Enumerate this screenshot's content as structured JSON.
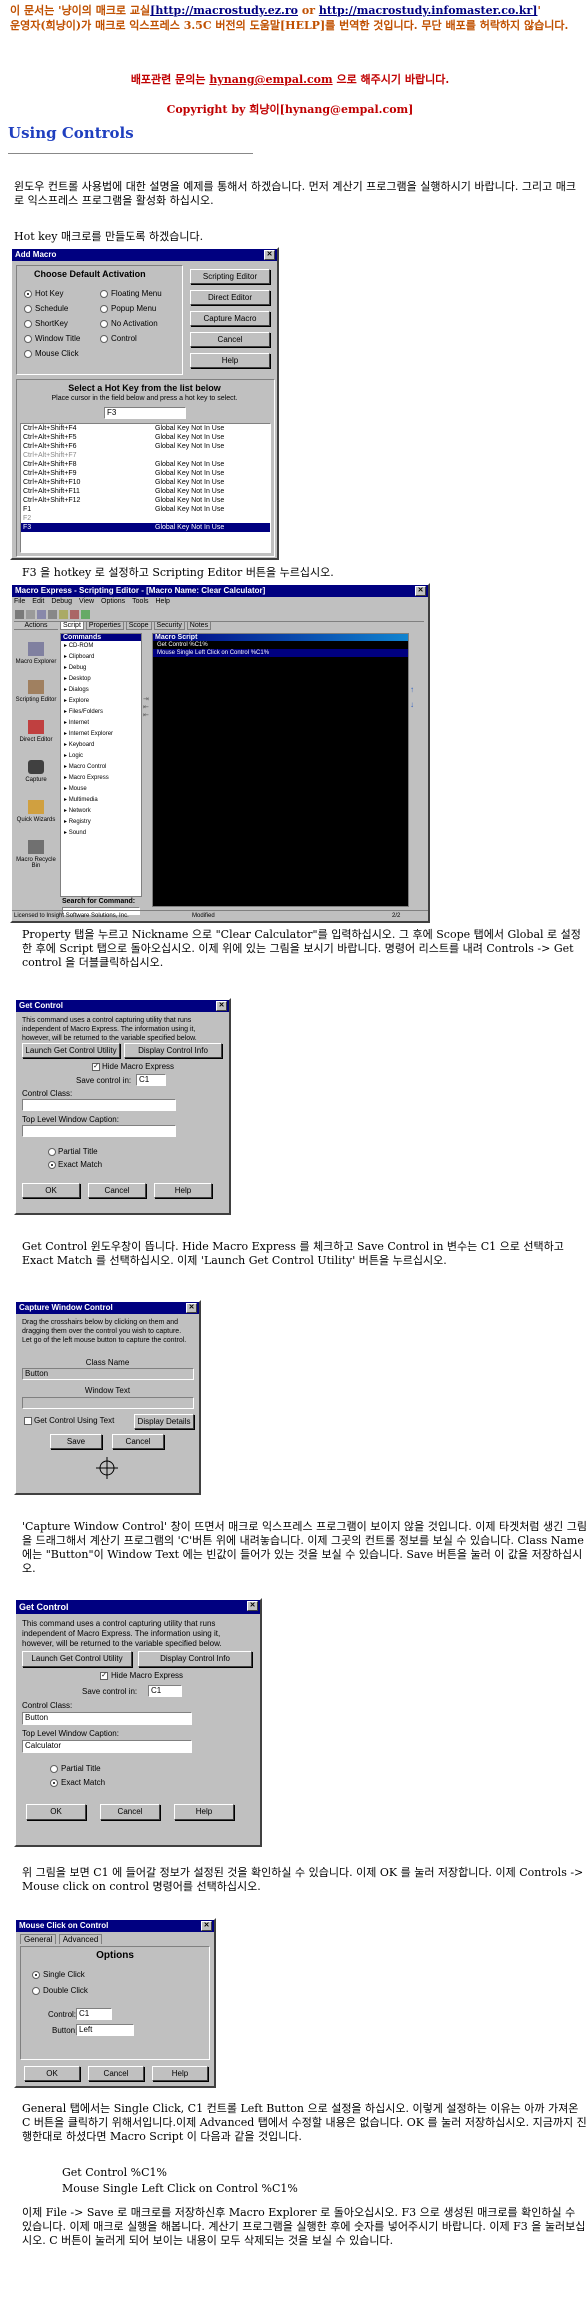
{
  "header": {
    "line1_pre": "이 문서는 '냥이의 매크로 교실",
    "link1": "[http://macrostudy.ez.ro",
    "or": " or ",
    "link2": "http://macrostudy.infomaster.co.kr]",
    "line1_post": "'",
    "line2": "운영자(희냥이)가 매크로 익스프레스 3.5C 버전의 도움말[HELP]를 번역한 것입니다. 무단 배포를 허락하지 않습니다.",
    "contact_pre": "배포관련 문의는 ",
    "contact_email": "hynang@empal.com",
    "contact_post": " 으로 해주시기 바랍니다.",
    "copyright_pre": "Copyright by 희냥이[",
    "copyright_email": "hynang@empal.com",
    "copyright_post": "]"
  },
  "section_title": "Using Controls",
  "paragraphs": {
    "p1": "윈도우 컨트롤 사용법에 대한 설명을 예제를 통해서 하겠습니다. 먼저 계산기 프로그램을 실행하시기 바랍니다. 그리고 매크로 익스프레스 프로그램을 활성화 하십시오.",
    "p2": "Hot key 매크로를 만들도록 하겠습니다.",
    "p3": "F3 을 hotkey 로 설정하고 Scripting Editor 버튼을 누르십시오.",
    "p4": "Property 탭을 누르고 Nickname 으로 \"Clear Calculator\"를 입력하십시오. 그 후에 Scope 탭에서 Global 로 설정한 후에 Script 탭으로 돌아오십시오. 이제 위에 있는 그림을 보시기 바랍니다. 명령어 리스트를 내려 Controls -> Get control 을 더블클릭하십시오.",
    "p5": "Get Control 윈도우창이 뜹니다. Hide Macro Express 를 체크하고 Save Control in 변수는 C1 으로 선택하고 Exact Match 를 선택하십시오. 이제 'Launch Get Control Utility' 버튼을 누르십시오.",
    "p6": "'Capture Window Control' 창이 뜨면서 매크로 익스프레스 프로그램이 보이지 않을 것입니다. 이제 타겟처럼 생긴 그림을 드래그해서 계산기 프로그램의 'C'버튼 위에 내려놓습니다. 이제 그곳의 컨트롤 정보를 보실 수 있습니다. Class Name 에는 \"Button\"이 Window Text 에는 빈값이 들어가 있는 것을 보실 수 있습니다. Save 버튼을 눌러 이 값을 저장하십시오.",
    "p7": "위 그림을 보면 C1 에 들어갈 정보가 설정된 것을 확인하실 수 있습니다. 이제 OK 를 눌러 저장합니다. 이제 Controls -> Mouse click on control 명령어를 선택하십시오.",
    "p8": "General 탭에서는 Single Click, C1 컨트롤 Left Button 으로 설정을 하십시오. 이렇게 설정하는 이유는 아까 가져온 C 버튼을 클릭하기 위해서입니다.이제 Advanced 탭에서 수정할 내용은 없습니다. OK 를 눌러 저장하십시오. 지금까지 진행한대로 하셨다면 Macro Script 이 다음과 같을 것입니다.",
    "code1": "Get Control %C1%",
    "code2": "Mouse Single Left Click on Control %C1%",
    "p9": "이제 File -> Save 로 매크로를 저장하신후 Macro Explorer 로 돌아오십시오. F3 으로 생성된 매크로를 확인하실 수 있습니다. 이제 매크로 실행을 해봅니다. 계산기 프로그램을 실행한 후에 숫자를 넣어주시기 바랍니다. 이제 F3 을 눌러보십시오. C 버튼이 눌러게 되어 보이는 내용이 모두 삭제되는 것을 보실 수 있습니다."
  },
  "add_macro": {
    "title": "Add Macro",
    "activation_title": "Choose Default Activation",
    "options": [
      "Hot Key",
      "Schedule",
      "ShortKey",
      "Window Title",
      "Mouse Click",
      "Floating Menu",
      "Popup Menu",
      "No Activation",
      "Control"
    ],
    "buttons": [
      "Scripting Editor",
      "Direct Editor",
      "Capture Macro",
      "Cancel",
      "Help"
    ],
    "hotkey_title": "Select a Hot Key from the list below",
    "hotkey_hint": "Place cursor in the field below and press a hot key to select.",
    "hotkey_value": "F3",
    "rows": [
      [
        "Ctrl+Alt+Shift+F4",
        "Global Key Not In Use"
      ],
      [
        "Ctrl+Alt+Shift+F5",
        "Global Key Not In Use"
      ],
      [
        "Ctrl+Alt+Shift+F6",
        "Global Key Not In Use"
      ],
      [
        "Ctrl+Alt+Shift+F7",
        ""
      ],
      [
        "Ctrl+Alt+Shift+F8",
        "Global Key Not In Use"
      ],
      [
        "Ctrl+Alt+Shift+F9",
        "Global Key Not In Use"
      ],
      [
        "Ctrl+Alt+Shift+F10",
        "Global Key Not In Use"
      ],
      [
        "Ctrl+Alt+Shift+F11",
        "Global Key Not In Use"
      ],
      [
        "Ctrl+Alt+Shift+F12",
        "Global Key Not In Use"
      ],
      [
        "F1",
        "Global Key Not In Use"
      ],
      [
        "F2",
        ""
      ],
      [
        "F3",
        "Global Key Not In Use"
      ]
    ]
  },
  "scripting_editor": {
    "title": "Macro Express - Scripting Editor - [Macro Name: Clear Calculator]",
    "menu": [
      "File",
      "Edit",
      "Debug",
      "View",
      "Options",
      "Tools",
      "Help"
    ],
    "left_header": "Actions",
    "left_items": [
      "Macro Explorer",
      "Scripting Editor",
      "Direct Editor",
      "Capture",
      "Quick Wizards",
      "Macro Recycle Bin"
    ],
    "tabs": [
      "Script",
      "Properties",
      "Scope",
      "Security",
      "Notes"
    ],
    "commands_header": "Commands",
    "commands": [
      "CD-ROM",
      "Clipboard",
      "Debug",
      "Desktop",
      "Dialogs",
      "Explore",
      "Files/Folders",
      "Internet",
      "Internet Explorer",
      "Keyboard",
      "Logic",
      "Macro Control",
      "Macro Express",
      "Mouse",
      "Multimedia",
      "Network",
      "Registry",
      "Sound"
    ],
    "search_label": "Search for Command:",
    "script_header": "Macro Script",
    "script_lines": [
      "Get Control %C1%",
      "Mouse Single Left Click on Control %C1%"
    ],
    "status_left": "Licensed to Insight Software Solutions, Inc.",
    "status_mid": "Modified",
    "status_right": "2/2"
  },
  "get_control_1": {
    "title": "Get Control",
    "description": "This command uses a control capturing utility that runs independent of Macro Express. The information using it, however, will be returned to the variable specified below.",
    "launch_btn": "Launch Get Control Utility",
    "display_btn": "Display Control Info",
    "hide_label": "Hide Macro Express",
    "save_label": "Save control in:",
    "save_value": "C1",
    "class_label": "Control Class:",
    "class_value": "",
    "top_label": "Top Level Window Caption:",
    "top_value": "",
    "partial": "Partial Title",
    "exact": "Exact Match",
    "ok": "OK",
    "cancel": "Cancel",
    "help": "Help"
  },
  "capture": {
    "title": "Capture Window Control",
    "description": "Drag the crosshairs below by clicking on them and dragging them over the control you wish to capture. Let go of the left mouse button to capture the control.",
    "class_label": "Class Name",
    "class_value": "Button",
    "window_label": "Window Text",
    "window_value": "",
    "using_text": "Get Control Using Text",
    "display": "Display Details",
    "save": "Save",
    "cancel": "Cancel"
  },
  "get_control_2": {
    "title": "Get Control",
    "description": "This command uses a control capturing utility that runs independent of Macro Express. The information using it, however, will be returned to the variable specified below.",
    "launch_btn": "Launch Get Control Utility",
    "display_btn": "Display Control Info",
    "hide_label": "Hide Macro Express",
    "save_label": "Save control in:",
    "save_value": "C1",
    "class_label": "Control Class:",
    "class_value": "Button",
    "top_label": "Top Level Window Caption:",
    "top_value": "Calculator",
    "partial": "Partial Title",
    "exact": "Exact Match",
    "ok": "OK",
    "cancel": "Cancel",
    "help": "Help"
  },
  "mouse_click": {
    "title": "Mouse Click on Control",
    "tab_general": "General",
    "tab_advanced": "Advanced",
    "options_title": "Options",
    "single": "Single Click",
    "double": "Double Click",
    "control_label": "Control:",
    "control_value": "C1",
    "button_label": "Button:",
    "button_value": "Left",
    "ok": "OK",
    "cancel": "Cancel",
    "help": "Help"
  }
}
